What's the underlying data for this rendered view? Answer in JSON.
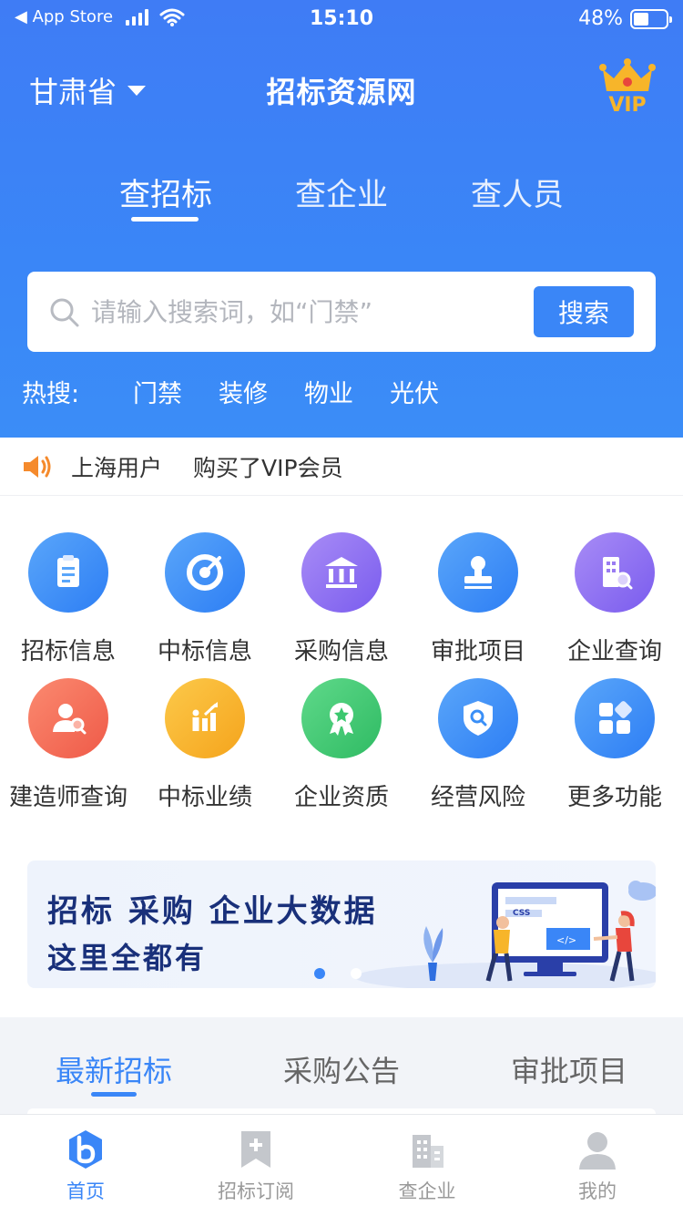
{
  "status_bar": {
    "back_app": "◀ App Store",
    "time": "15:10",
    "battery": "48%",
    "battery_level": 0.48
  },
  "header": {
    "province": "甘肃省",
    "title": "招标资源网",
    "vip": "VIP",
    "tabs": [
      {
        "label": "查招标",
        "active": true
      },
      {
        "label": "查企业",
        "active": false
      },
      {
        "label": "查人员",
        "active": false
      }
    ],
    "search": {
      "placeholder": "请输入搜索词，如“门禁”",
      "value": "",
      "button": "搜索"
    },
    "hot": {
      "label": "热搜:",
      "tags": [
        "门禁",
        "装修",
        "物业",
        "光伏"
      ]
    }
  },
  "notice": {
    "user": "上海用户",
    "text": "购买了VIP会员"
  },
  "features": [
    {
      "label": "招标信息",
      "icon": "clipboard-icon",
      "color": "#3a8ff7"
    },
    {
      "label": "中标信息",
      "icon": "target-icon",
      "color": "#3a8ff7"
    },
    {
      "label": "采购信息",
      "icon": "bank-icon",
      "color": "#8a6cf0"
    },
    {
      "label": "审批项目",
      "icon": "stamp-icon",
      "color": "#3a8ff7"
    },
    {
      "label": "企业查询",
      "icon": "building-search-icon",
      "color": "#8a6cf0"
    },
    {
      "label": "建造师查询",
      "icon": "person-search-icon",
      "color": "#f5705a"
    },
    {
      "label": "中标业绩",
      "icon": "chart-people-icon",
      "color": "#f7b12c"
    },
    {
      "label": "企业资质",
      "icon": "medal-icon",
      "color": "#3cc86f"
    },
    {
      "label": "经营风险",
      "icon": "shield-search-icon",
      "color": "#3a8ff7"
    },
    {
      "label": "更多功能",
      "icon": "apps-grid-icon",
      "color": "#3a8ff7"
    }
  ],
  "banner": {
    "line1": "招标 采购 企业大数据",
    "line2": "这里全都有",
    "art_label": "CSS",
    "active_dot": 0
  },
  "sub_tabs": [
    {
      "label": "最新招标",
      "active": true
    },
    {
      "label": "采购公告",
      "active": false
    },
    {
      "label": "审批项目",
      "active": false
    }
  ],
  "bottom_nav": [
    {
      "label": "首页",
      "icon": "home-logo-icon",
      "active": true
    },
    {
      "label": "招标订阅",
      "icon": "bookmark-plus-icon",
      "active": false
    },
    {
      "label": "查企业",
      "icon": "buildings-icon",
      "active": false
    },
    {
      "label": "我的",
      "icon": "user-icon",
      "active": false
    }
  ],
  "colors": {
    "primary": "#3a86f7",
    "banner_text": "#19307a",
    "vip_gold": "#f7b52a"
  }
}
